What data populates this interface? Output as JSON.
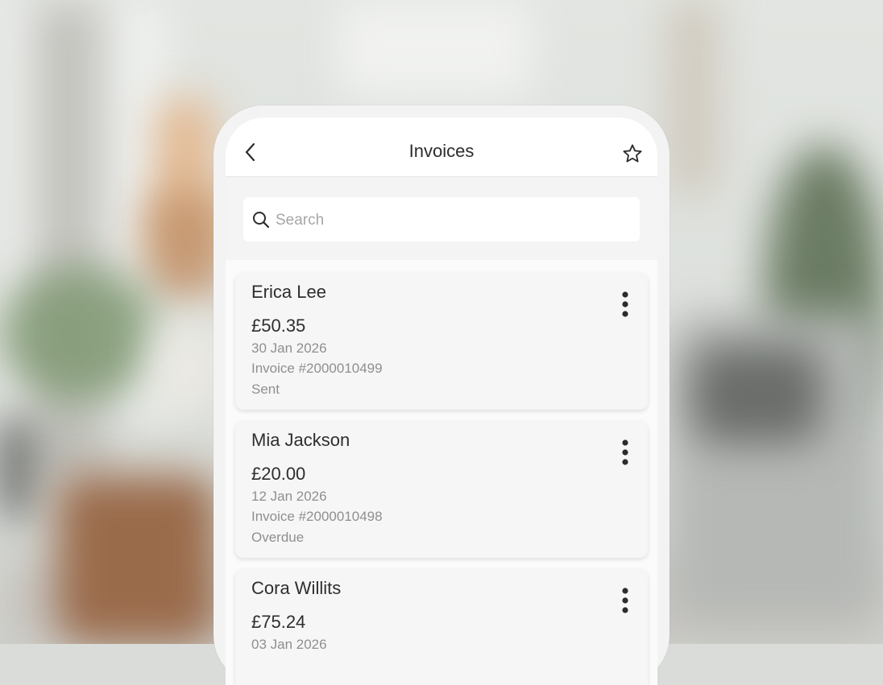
{
  "header": {
    "title": "Invoices"
  },
  "search": {
    "placeholder": "Search",
    "value": ""
  },
  "invoices": [
    {
      "name": "Erica Lee",
      "amount": "£50.35",
      "date": "30 Jan 2026",
      "number": "Invoice #2000010499",
      "status": "Sent"
    },
    {
      "name": "Mia Jackson",
      "amount": "£20.00",
      "date": "12 Jan 2026",
      "number": "Invoice #2000010498",
      "status": "Overdue"
    },
    {
      "name": "Cora Willits",
      "amount": "£75.24",
      "date": "03 Jan 2026",
      "number": "",
      "status": ""
    }
  ],
  "icons": {
    "back": "chevron-left-icon",
    "favorite": "star-outline-icon",
    "search": "search-icon",
    "more": "more-vertical-icon"
  },
  "colors": {
    "text": "#2e2e2e",
    "muted": "#8f8f8f",
    "placeholder": "#a6a6a6"
  }
}
